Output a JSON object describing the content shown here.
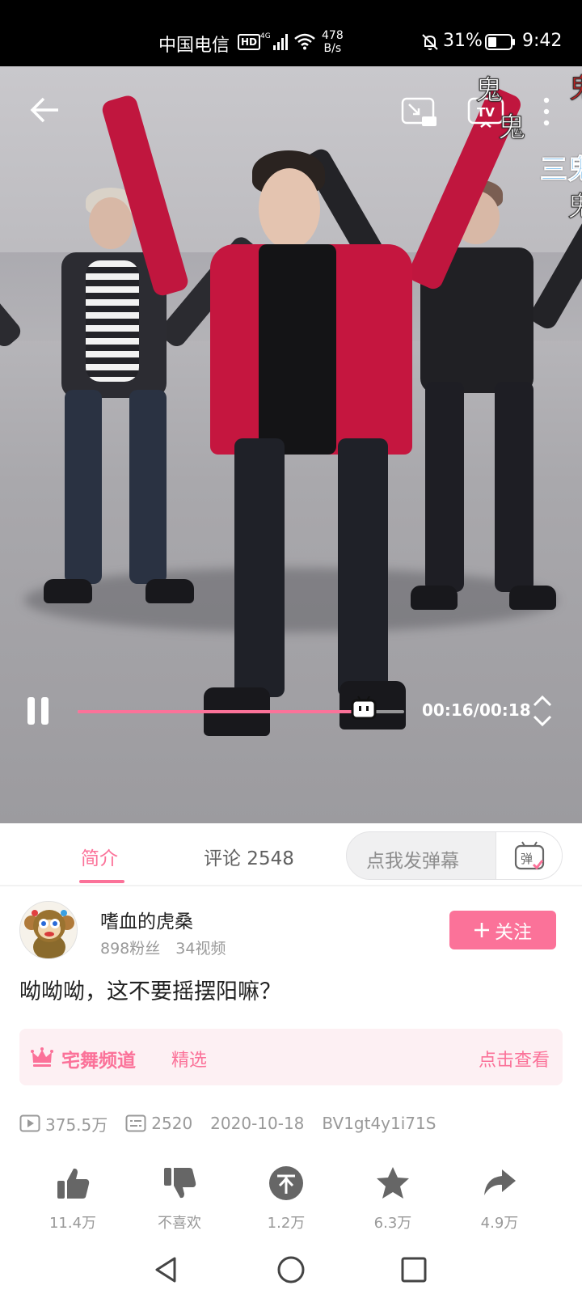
{
  "status_bar": {
    "carrier": "中国电信",
    "hd": "HD",
    "network": "4G",
    "speed_value": "478",
    "speed_unit": "B/s",
    "battery": "31%",
    "time": "9:42"
  },
  "player": {
    "danmaku": [
      "鬼",
      "鬼",
      "三鬼",
      "鬼",
      "鬼"
    ],
    "progress_fraction": 0.877,
    "timecode": "00:16/00:18",
    "accent": "#fb7299"
  },
  "tabs": {
    "intro": "简介",
    "comments": "评论 2548",
    "danmaku_placeholder": "点我发弹幕",
    "danmaku_button": "弹"
  },
  "uploader": {
    "name": "嗜血的虎桑",
    "stats": "898粉丝　34视频",
    "follow": "关注"
  },
  "video": {
    "title": "呦呦呦，这不要摇摆阳嘛？"
  },
  "channel": {
    "name": "宅舞频道",
    "tag": "精选",
    "view": "点击查看"
  },
  "meta": {
    "plays": "375.5万",
    "danmaku_count": "2520",
    "date": "2020-10-18",
    "bvid": "BV1gt4y1i71S"
  },
  "actions": {
    "like": "11.4万",
    "dislike": "不喜欢",
    "coin": "1.2万",
    "favorite": "6.3万",
    "share": "4.9万"
  },
  "icons": {
    "back": "arrow-left-icon",
    "pip": "picture-in-picture-icon",
    "tv": "tv-cast-icon",
    "more": "more-vertical-icon",
    "pause": "pause-icon",
    "fullscreen": "expand-icon",
    "crown": "crown-icon",
    "play_count": "play-icon",
    "danmaku": "danmaku-list-icon",
    "like": "thumb-up-icon",
    "dislike": "thumb-down-icon",
    "coin": "coin-icon",
    "favorite": "star-icon",
    "share": "share-arrow-icon"
  }
}
